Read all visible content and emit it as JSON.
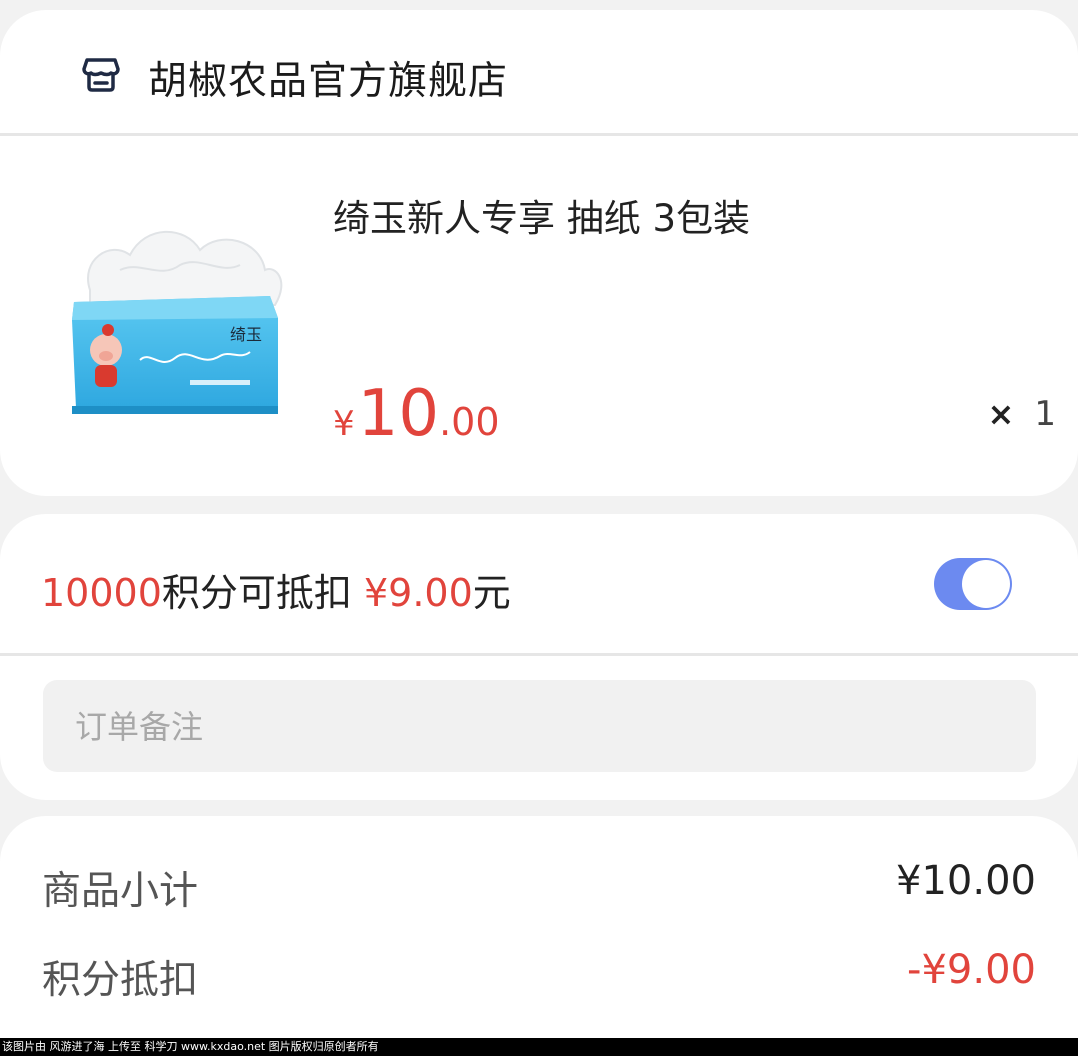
{
  "store": {
    "name": "胡椒农品官方旗舰店",
    "icon": "store-icon"
  },
  "product": {
    "title": "绮玉新人专享 抽纸 3包装",
    "image_icon": "tissue-pack-image",
    "price": {
      "symbol": "¥",
      "integer": "10",
      "decimal": ".00"
    },
    "quantity_prefix": "×",
    "quantity": "1"
  },
  "points": {
    "amount": "10000",
    "text_mid": "积分可抵扣",
    "deduct_value": "¥9.00",
    "suffix": "元",
    "toggle_on": true,
    "toggle_color": "#6c8af0"
  },
  "note": {
    "placeholder": "订单备注"
  },
  "summary": {
    "subtotal_label": "商品小计",
    "subtotal_value": "¥10.00",
    "deduct_label": "积分抵扣",
    "deduct_value": "-¥9.00"
  },
  "watermark": "该图片由 风游进了海 上传至 科学刀 www.kxdao.net 图片版权归原创者所有",
  "colors": {
    "accent_red": "#e1443c",
    "toggle_blue": "#6c8af0",
    "background": "#f2f2f2"
  }
}
